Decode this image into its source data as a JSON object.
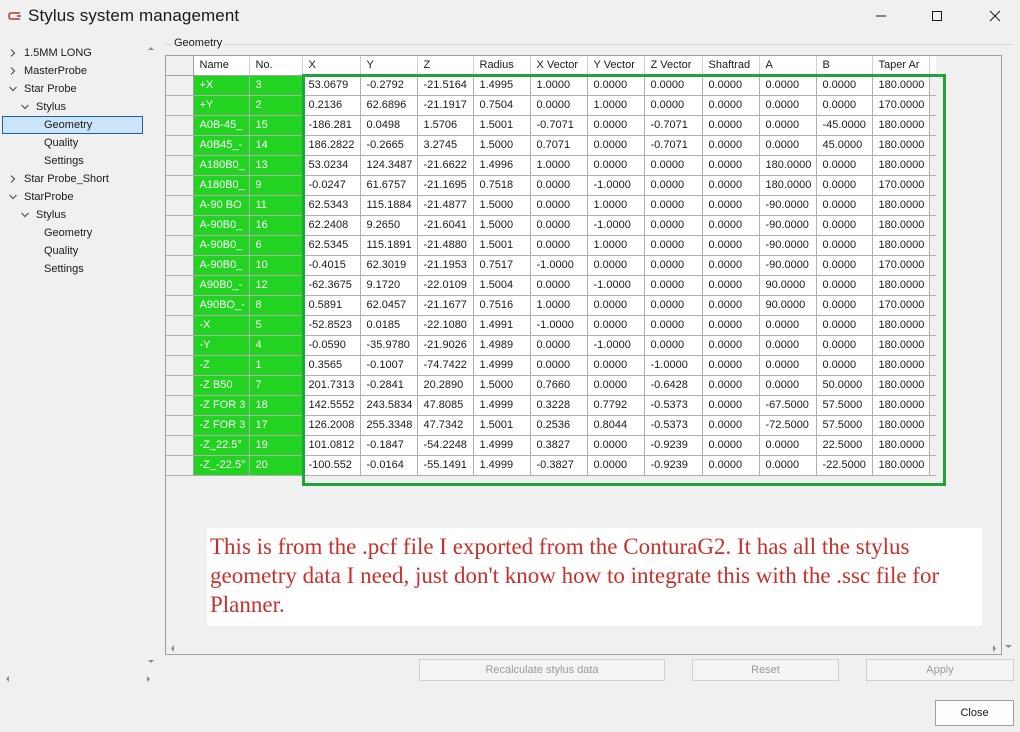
{
  "window": {
    "title": "Stylus system management",
    "close_label": "Close"
  },
  "tree": {
    "items": [
      {
        "label": "1.5MM LONG",
        "expanded": false
      },
      {
        "label": "MasterProbe",
        "expanded": false
      },
      {
        "label": "Star Probe",
        "expanded": true
      },
      {
        "label": "Stylus",
        "expanded": true
      },
      {
        "label": "Geometry",
        "selected": true
      },
      {
        "label": "Quality"
      },
      {
        "label": "Settings"
      },
      {
        "label": "Star Probe_Short",
        "expanded": false
      },
      {
        "label": "StarProbe",
        "expanded": true
      },
      {
        "label": "Stylus",
        "expanded": true
      },
      {
        "label": "Geometry"
      },
      {
        "label": "Quality"
      },
      {
        "label": "Settings"
      }
    ]
  },
  "geometry": {
    "group_label": "Geometry",
    "columns": [
      "Name",
      "No.",
      "X",
      "Y",
      "Z",
      "Radius",
      "X Vector",
      "Y Vector",
      "Z Vector",
      "Shaftrad",
      "A",
      "B",
      "Taper Ar"
    ],
    "rows": [
      [
        "+X",
        "3",
        "53.0679",
        "-0.2792",
        "-21.5164",
        "1.4995",
        "1.0000",
        "0.0000",
        "0.0000",
        "0.0000",
        "0.0000",
        "0.0000",
        "180.0000"
      ],
      [
        "+Y",
        "2",
        "0.2136",
        "62.6896",
        "-21.1917",
        "0.7504",
        "0.0000",
        "1.0000",
        "0.0000",
        "0.0000",
        "0.0000",
        "0.0000",
        "170.0000"
      ],
      [
        "A0B-45_",
        "15",
        "-186.281",
        "0.0498",
        "1.5706",
        "1.5001",
        "-0.7071",
        "0.0000",
        "-0.7071",
        "0.0000",
        "0.0000",
        "-45.0000",
        "180.0000"
      ],
      [
        "A0B45_-",
        "14",
        "186.2822",
        "-0.2665",
        "3.2745",
        "1.5000",
        "0.7071",
        "0.0000",
        "-0.7071",
        "0.0000",
        "0.0000",
        "45.0000",
        "180.0000"
      ],
      [
        "A180B0_",
        "13",
        "53.0234",
        "124.3487",
        "-21.6622",
        "1.4996",
        "1.0000",
        "0.0000",
        "0.0000",
        "0.0000",
        "180.0000",
        "0.0000",
        "180.0000"
      ],
      [
        "A180B0_",
        "9",
        "-0.0247",
        "61.6757",
        "-21.1695",
        "0.7518",
        "0.0000",
        "-1.0000",
        "0.0000",
        "0.0000",
        "180.0000",
        "0.0000",
        "170.0000"
      ],
      [
        "A-90 BO",
        "11",
        "62.5343",
        "115.1884",
        "-21.4877",
        "1.5000",
        "0.0000",
        "1.0000",
        "0.0000",
        "0.0000",
        "-90.0000",
        "0.0000",
        "180.0000"
      ],
      [
        "A-90B0_",
        "16",
        "62.2408",
        "9.2650",
        "-21.6041",
        "1.5000",
        "0.0000",
        "-1.0000",
        "0.0000",
        "0.0000",
        "-90.0000",
        "0.0000",
        "180.0000"
      ],
      [
        "A-90B0_",
        "6",
        "62.5345",
        "115.1891",
        "-21.4880",
        "1.5001",
        "0.0000",
        "1.0000",
        "0.0000",
        "0.0000",
        "-90.0000",
        "0.0000",
        "180.0000"
      ],
      [
        "A-90B0_",
        "10",
        "-0.4015",
        "62.3019",
        "-21.1953",
        "0.7517",
        "-1.0000",
        "0.0000",
        "0.0000",
        "0.0000",
        "-90.0000",
        "0.0000",
        "170.0000"
      ],
      [
        "A90B0_-",
        "12",
        "-62.3675",
        "9.1720",
        "-22.0109",
        "1.5004",
        "0.0000",
        "-1.0000",
        "0.0000",
        "0.0000",
        "90.0000",
        "0.0000",
        "180.0000"
      ],
      [
        "A90BO_-",
        "8",
        "0.5891",
        "62.0457",
        "-21.1677",
        "0.7516",
        "1.0000",
        "0.0000",
        "0.0000",
        "0.0000",
        "90.0000",
        "0.0000",
        "170.0000"
      ],
      [
        "-X",
        "5",
        "-52.8523",
        "0.0185",
        "-22.1080",
        "1.4991",
        "-1.0000",
        "0.0000",
        "0.0000",
        "0.0000",
        "0.0000",
        "0.0000",
        "180.0000"
      ],
      [
        "-Y",
        "4",
        "-0.0590",
        "-35.9780",
        "-21.9026",
        "1.4989",
        "0.0000",
        "-1.0000",
        "0.0000",
        "0.0000",
        "0.0000",
        "0.0000",
        "180.0000"
      ],
      [
        "-Z",
        "1",
        "0.3565",
        "-0.1007",
        "-74.7422",
        "1.4999",
        "0.0000",
        "0.0000",
        "-1.0000",
        "0.0000",
        "0.0000",
        "0.0000",
        "180.0000"
      ],
      [
        "-Z B50",
        "7",
        "201.7313",
        "-0.2841",
        "20.2890",
        "1.5000",
        "0.7660",
        "0.0000",
        "-0.6428",
        "0.0000",
        "0.0000",
        "50.0000",
        "180.0000"
      ],
      [
        "-Z FOR 3",
        "18",
        "142.5552",
        "243.5834",
        "47.8085",
        "1.4999",
        "0.3228",
        "0.7792",
        "-0.5373",
        "0.0000",
        "-67.5000",
        "57.5000",
        "180.0000"
      ],
      [
        "-Z FOR 3",
        "17",
        "126.2008",
        "255.3348",
        "47.7342",
        "1.5001",
        "0.2536",
        "0.8044",
        "-0.5373",
        "0.0000",
        "-72.5000",
        "57.5000",
        "180.0000"
      ],
      [
        "-Z_22.5°",
        "19",
        "101.0812",
        "-0.1847",
        "-54.2248",
        "1.4999",
        "0.3827",
        "0.0000",
        "-0.9239",
        "0.0000",
        "0.0000",
        "22.5000",
        "180.0000"
      ],
      [
        "-Z_-22.5°",
        "20",
        "-100.552",
        "-0.0164",
        "-55.1491",
        "1.4999",
        "-0.3827",
        "0.0000",
        "-0.9239",
        "0.0000",
        "0.0000",
        "-22.5000",
        "180.0000"
      ]
    ]
  },
  "annotation": {
    "text": "This is from the .pcf file I exported from the ConturaG2. It has all the stylus geometry data I need, just don't know how to integrate this with the .ssc file for Planner."
  },
  "buttons": {
    "recalculate": "Recalculate stylus data",
    "reset": "Reset",
    "apply": "Apply",
    "close": "Close"
  },
  "colors": {
    "name_col_bg": "#22d322",
    "highlight_box": "#1fa33c",
    "annotation_text": "#c8302c",
    "selection_bg": "#cce4f7"
  }
}
